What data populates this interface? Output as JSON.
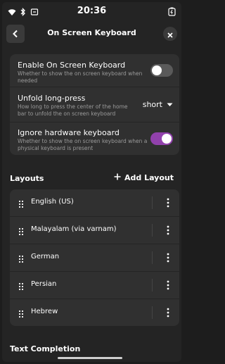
{
  "status": {
    "time": "20:36"
  },
  "header": {
    "title": "On Screen Keyboard"
  },
  "settings": {
    "enable": {
      "title": "Enable On Screen Keyboard",
      "subtitle": "Whether to show the on screen keyboard when needed",
      "on": false
    },
    "unfold": {
      "title": "Unfold long-press",
      "subtitle": "How long to press the center of the home bar to unfold the on screen keyboard",
      "value": "short"
    },
    "ignore": {
      "title": "Ignore hardware keyboard",
      "subtitle": "Whether to show the on screen keyboard when a physical keyboard is present",
      "on": true
    }
  },
  "layouts": {
    "label": "Layouts",
    "add_label": "Add Layout",
    "items": [
      {
        "name": "English (US)"
      },
      {
        "name": "Malayalam (via varnam)"
      },
      {
        "name": "German"
      },
      {
        "name": "Persian"
      },
      {
        "name": "Hebrew"
      }
    ]
  },
  "completion": {
    "label": "Text Completion"
  },
  "colors": {
    "accent": "#9141ac",
    "background": "#242424",
    "card": "#303030"
  },
  "icons": [
    "wifi-icon",
    "bluetooth-icon",
    "screen-rotation-icon",
    "battery-charging-icon",
    "back-arrow-icon",
    "close-icon",
    "chevron-down-icon",
    "plus-icon",
    "drag-handle-icon",
    "more-vertical-icon"
  ]
}
